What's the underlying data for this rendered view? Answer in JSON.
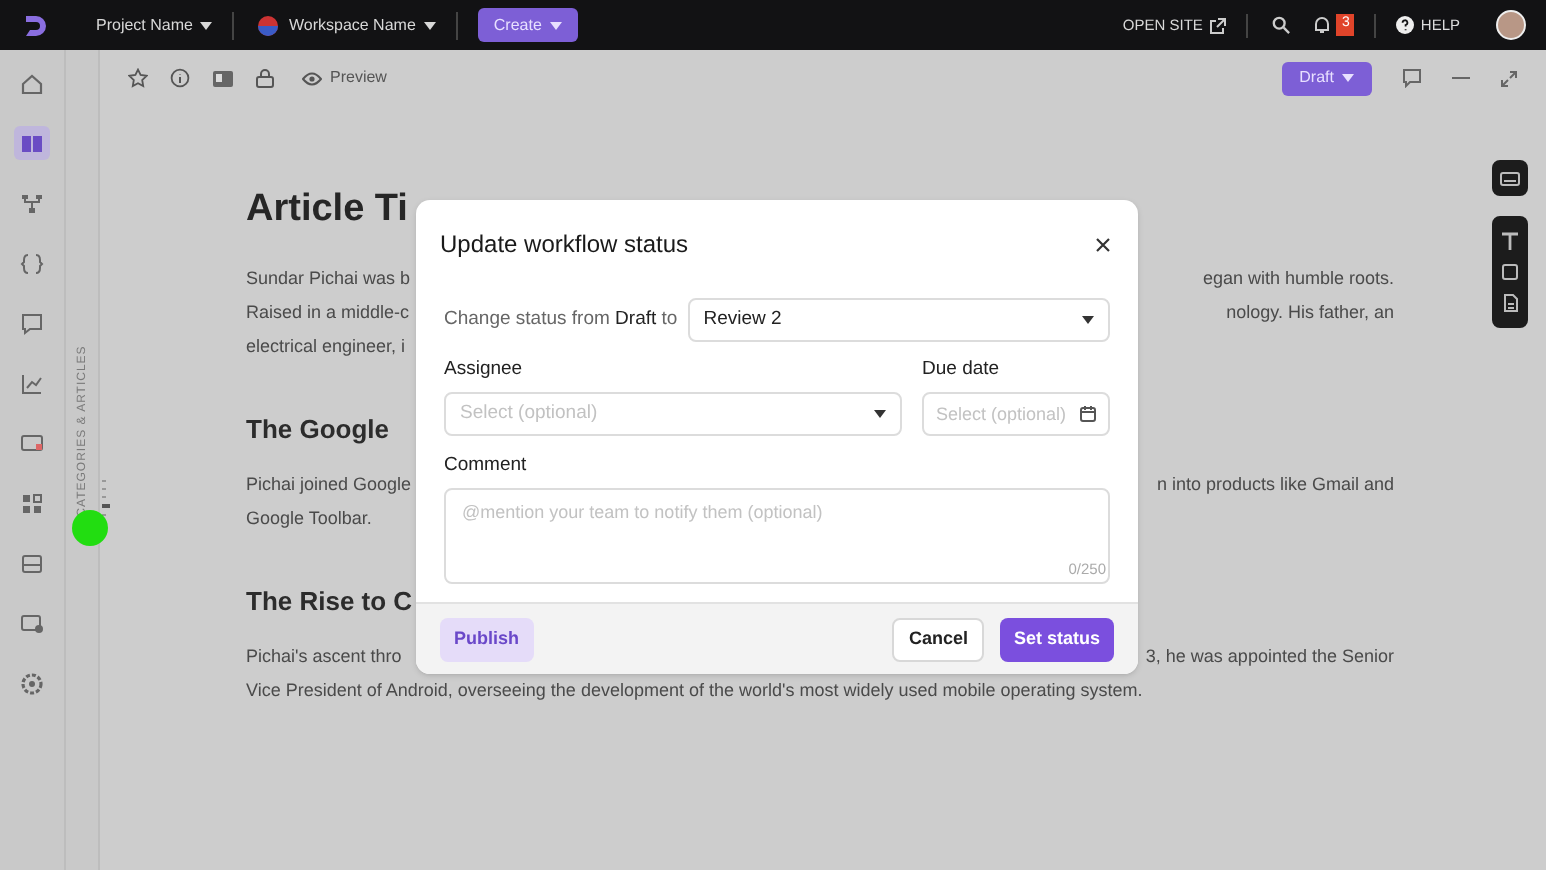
{
  "top_bar": {
    "project": "Project Name",
    "workspace": "Workspace Name",
    "create_button": "Create",
    "open_site": "OPEN SITE",
    "notification_count": "3",
    "help": "HELP"
  },
  "toolbar": {
    "preview": "Preview",
    "status_button": "Draft"
  },
  "sidebar": {
    "items": [
      {
        "selected": false
      },
      {
        "selected": true
      },
      {
        "selected": false
      },
      {
        "selected": false
      },
      {
        "selected": false
      },
      {
        "selected": false
      },
      {
        "selected": false
      },
      {
        "selected": false
      },
      {
        "selected": false
      },
      {
        "selected": false
      },
      {
        "selected": false
      }
    ]
  },
  "category_strip": {
    "label": "CATEGORIES & ARTICLES"
  },
  "article": {
    "title": "Article Ti",
    "blocks": [
      {
        "kind": "paragraph",
        "lines": [
          {
            "left": "Sundar Pichai was b",
            "right": "egan with humble roots."
          },
          {
            "left": "Raised in a middle-c",
            "right": "nology. His father, an"
          },
          {
            "left": "electrical engineer, i"
          }
        ]
      },
      {
        "kind": "heading",
        "text": "The Google"
      },
      {
        "kind": "paragraph",
        "lines": [
          {
            "left": "Pichai joined Google",
            "right": "n into products like Gmail and"
          },
          {
            "left": "Google Toolbar."
          }
        ]
      },
      {
        "kind": "heading",
        "text": "The Rise to C"
      },
      {
        "kind": "paragraph",
        "lines": [
          {
            "left": "Pichai's ascent thro",
            "right": "3, he was appointed the Senior"
          },
          {
            "left": "Vice President of Android, overseeing the development of the world's most widely used mobile operating system."
          }
        ]
      }
    ]
  },
  "dialog": {
    "title": "Update workflow status",
    "status_prompt": "Change status from **Draft** to",
    "status_value": "Review 2",
    "assignee": {
      "label": "Assignee",
      "placeholder": "Select (optional)"
    },
    "due_date": {
      "label": "Due date",
      "placeholder": "Select (optional)"
    },
    "comment": {
      "label": "Comment",
      "placeholder": "@mention your team to notify them (optional)",
      "counter": "0/250"
    },
    "buttons": {
      "publish": "Publish",
      "cancel": "Cancel",
      "submit": "Set status"
    }
  }
}
